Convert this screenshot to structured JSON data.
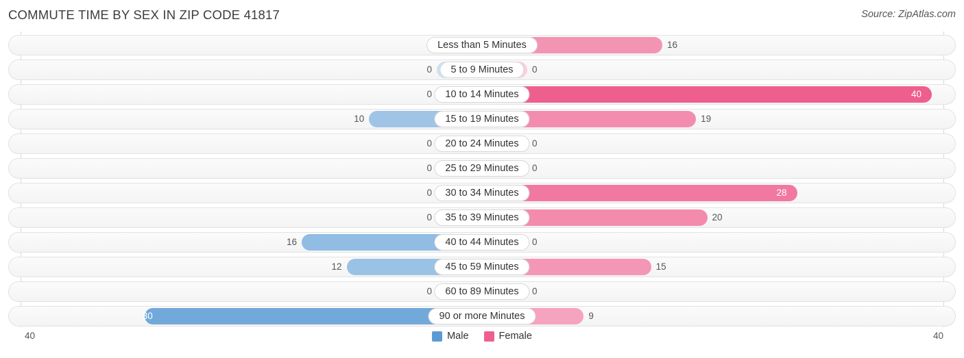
{
  "header": {
    "title": "COMMUTE TIME BY SEX IN ZIP CODE 41817",
    "source": "Source: ZipAtlas.com"
  },
  "axis": {
    "left_label": "40",
    "right_label": "40"
  },
  "legend": {
    "items": [
      {
        "label": "Male",
        "color": "#5b9bd5"
      },
      {
        "label": "Female",
        "color": "#ee5f8e"
      }
    ]
  },
  "colors": {
    "male": "#5b9bd5",
    "female": "#ee5f8e",
    "male_light": "#aac8ea",
    "female_light": "#f9b4cb",
    "track": "#f7f7f7",
    "gridline": "#d8d8d8"
  },
  "chart_data": {
    "type": "bar",
    "title": "COMMUTE TIME BY SEX IN ZIP CODE 41817",
    "subtitle": "",
    "xlabel": "",
    "ylabel": "",
    "orientation": "horizontal-diverging",
    "legend_position": "bottom",
    "grid": true,
    "xlim": [
      0,
      40
    ],
    "axis_max": 40,
    "categories": [
      "Less than 5 Minutes",
      "5 to 9 Minutes",
      "10 to 14 Minutes",
      "15 to 19 Minutes",
      "20 to 24 Minutes",
      "25 to 29 Minutes",
      "30 to 34 Minutes",
      "35 to 39 Minutes",
      "40 to 44 Minutes",
      "45 to 59 Minutes",
      "60 to 89 Minutes",
      "90 or more Minutes"
    ],
    "series": [
      {
        "name": "Male",
        "color": "#5b9bd5",
        "values": [
          0,
          0,
          0,
          10,
          0,
          0,
          0,
          0,
          16,
          12,
          0,
          30
        ]
      },
      {
        "name": "Female",
        "color": "#ee5f8e",
        "values": [
          16,
          0,
          40,
          19,
          0,
          0,
          28,
          20,
          0,
          15,
          0,
          9
        ]
      }
    ]
  }
}
